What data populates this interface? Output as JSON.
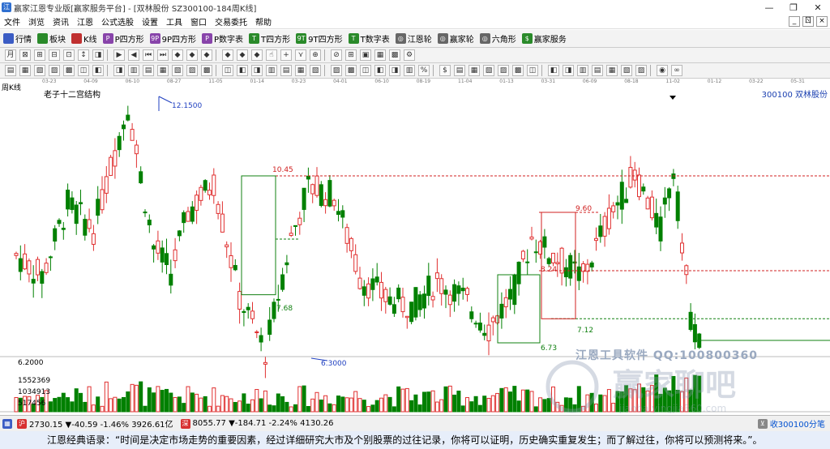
{
  "window": {
    "title": "赢家江恩专业版[赢家服务平台] - [双林股份  SZ300100-184周K线]",
    "app_icon": "江",
    "controls": [
      "—",
      "❐",
      "✕"
    ]
  },
  "menu": {
    "items": [
      "文件",
      "浏览",
      "资讯",
      "江恩",
      "公式选股",
      "设置",
      "工具",
      "窗口",
      "交易委托",
      "帮助"
    ],
    "right_buttons": [
      "_",
      "ㄖ",
      "×"
    ]
  },
  "toolbar1": [
    {
      "icon": "grid-icon",
      "label": "行情",
      "color": "#3b5cc4"
    },
    {
      "icon": "blocks-icon",
      "label": "板块",
      "color": "#2a8a2a"
    },
    {
      "icon": "candle-icon",
      "label": "K线",
      "color": "#c03030"
    },
    {
      "icon": "p-square-icon",
      "label": "P四方形",
      "color": "#8844aa",
      "ic": "P"
    },
    {
      "icon": "9p-square-icon",
      "label": "9P四方形",
      "color": "#8844aa",
      "ic": "9P"
    },
    {
      "icon": "p-number-icon",
      "label": "P数字表",
      "color": "#8844aa",
      "ic": "P"
    },
    {
      "icon": "t-square-icon",
      "label": "T四方形",
      "color": "#2a8a2a",
      "ic": "T"
    },
    {
      "icon": "9t-square-icon",
      "label": "9T四方形",
      "color": "#2a8a2a",
      "ic": "9T"
    },
    {
      "icon": "t-number-icon",
      "label": "T数字表",
      "color": "#2a8a2a",
      "ic": "T"
    },
    {
      "icon": "gann-wheel-icon",
      "label": "江恩轮",
      "color": "#666666",
      "ic": "◎"
    },
    {
      "icon": "winner-wheel-icon",
      "label": "赢家轮",
      "color": "#666666",
      "ic": "◎"
    },
    {
      "icon": "hexagon-icon",
      "label": "六角形",
      "color": "#666666",
      "ic": "◎"
    },
    {
      "icon": "dollar-icon",
      "label": "赢家服务",
      "color": "#2a8a2a",
      "ic": "$"
    }
  ],
  "toolbar2_icons": [
    "月",
    "⊠",
    "⊞",
    "⊟",
    "⊡",
    "↕",
    "◨",
    "▶",
    "◀",
    "⏮",
    "⏭",
    "◆",
    "◆",
    "◆",
    "◆",
    "◆",
    "◆",
    "☝",
    "+",
    "⋎",
    "⊕",
    "⊘",
    "⊞",
    "▣",
    "▦",
    "▩",
    "⚙"
  ],
  "toolbar3_icons": [
    "▤",
    "▦",
    "▧",
    "▨",
    "▩",
    "◫",
    "◧",
    "◨",
    "▥",
    "▤",
    "▦",
    "▧",
    "▨",
    "▩",
    "◫",
    "◧",
    "◨",
    "▥",
    "▤",
    "▦",
    "▧",
    "▨",
    "▩",
    "◫",
    "◧",
    "◨",
    "▥",
    "%",
    "$",
    "▤",
    "▦",
    "▧",
    "▨",
    "▩",
    "◫",
    "◧",
    "◨",
    "▥",
    "▤",
    "▦",
    "▧",
    "▨",
    "◉",
    "∞"
  ],
  "period_label": "周K线",
  "date_ticks": [
    "03-23",
    "04-09",
    "06-10",
    "08-27",
    "11-05",
    "01-14",
    "03-23",
    "04-01",
    "06-10",
    "08-19",
    "11-04",
    "01-13",
    "03-31",
    "06-09",
    "08-18",
    "11-02",
    "01-12",
    "03-22",
    "05-31",
    "08-08"
  ],
  "chart": {
    "title": "老子十二宫结构",
    "stock": "300100  双林股份",
    "annotations": [
      "12.1500",
      "10.45",
      "7.68",
      "6.3000",
      "9.60",
      "8.24",
      "7.12",
      "6.73"
    ],
    "y_labels": [
      "6.2000",
      "1552369",
      "1034913",
      "517456"
    ]
  },
  "chart_data": {
    "type": "candlestick",
    "price_range": [
      6.2,
      12.15
    ],
    "high": 12.15,
    "low": 6.3,
    "levels": [
      10.45,
      7.68,
      9.6,
      8.24,
      7.12,
      6.73
    ],
    "volume_ticks": [
      517456,
      1034913,
      1552369
    ]
  },
  "watermark": {
    "top_text": "江恩工具软件  QQ:100800360",
    "main_text": "赢家聊吧",
    "sub_text": "jiaoba.yingjia360.com"
  },
  "status": {
    "sh": {
      "label": "沪",
      "text": "2730.15 ▼-40.59 -1.46% 3926.61亿"
    },
    "sz": {
      "label": "深",
      "text": "8055.77 ▼-184.71 -2.24% 4130.26"
    },
    "right": "收300100分笔"
  },
  "quote": "江恩经典语录：“时间是决定市场走势的重要因素，经过详细研究大市及个别股票的过往记录，你将可以证明，历史确实重复发生；而了解过往，你将可以预测将来。”。"
}
